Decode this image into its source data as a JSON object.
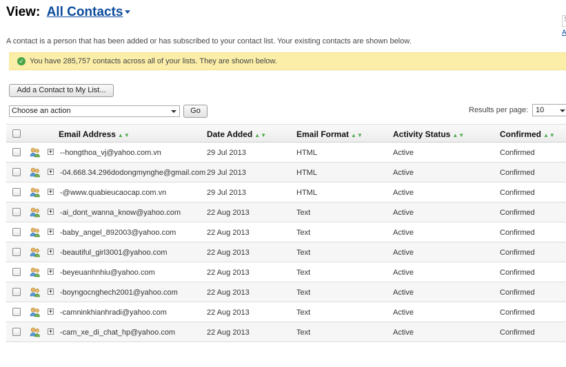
{
  "header": {
    "view_label": "View:",
    "view_value": "All Contacts",
    "edge_box_text": "S",
    "edge_link_text": "A"
  },
  "intro_text": "A contact is a person that has been added or has subscribed to your contact list. Your existing contacts are shown below.",
  "notice": {
    "text": "You have 285,757 contacts across all of your lists. They are shown below.",
    "icon": "check-circle-icon",
    "bg_color": "#fbeea9"
  },
  "toolbar": {
    "add_label": "Add a Contact to My List...",
    "action_value": "Choose an action",
    "go_label": "Go",
    "rpp_label": "Results per page:",
    "rpp_value": "10"
  },
  "columns": {
    "email": "Email Address",
    "date": "Date Added",
    "format": "Email Format",
    "status": "Activity Status",
    "confirmed": "Confirmed",
    "sort_icon": "sort-up-down-icon"
  },
  "rows": [
    {
      "email": "--hongthoa_vj@yahoo.com.vn",
      "date": "29 Jul 2013",
      "format": "HTML",
      "status": "Active",
      "confirmed": "Confirmed"
    },
    {
      "email": "-04.668.34.296dodongmynghe@gmail.com",
      "date": "29 Jul 2013",
      "format": "HTML",
      "status": "Active",
      "confirmed": "Confirmed"
    },
    {
      "email": "-@www.quabieucaocap.com.vn",
      "date": "29 Jul 2013",
      "format": "HTML",
      "status": "Active",
      "confirmed": "Confirmed"
    },
    {
      "email": "-ai_dont_wanna_know@yahoo.com",
      "date": "22 Aug 2013",
      "format": "Text",
      "status": "Active",
      "confirmed": "Confirmed"
    },
    {
      "email": "-baby_angel_892003@yahoo.com",
      "date": "22 Aug 2013",
      "format": "Text",
      "status": "Active",
      "confirmed": "Confirmed"
    },
    {
      "email": "-beautiful_girl3001@yahoo.com",
      "date": "22 Aug 2013",
      "format": "Text",
      "status": "Active",
      "confirmed": "Confirmed"
    },
    {
      "email": "-beyeuanhnhiu@yahoo.com",
      "date": "22 Aug 2013",
      "format": "Text",
      "status": "Active",
      "confirmed": "Confirmed"
    },
    {
      "email": "-boyngocnghech2001@yahoo.com",
      "date": "22 Aug 2013",
      "format": "Text",
      "status": "Active",
      "confirmed": "Confirmed"
    },
    {
      "email": "-camninkhianhradi@yahoo.com",
      "date": "22 Aug 2013",
      "format": "Text",
      "status": "Active",
      "confirmed": "Confirmed"
    },
    {
      "email": "-cam_xe_di_chat_hp@yahoo.com",
      "date": "22 Aug 2013",
      "format": "Text",
      "status": "Active",
      "confirmed": "Confirmed"
    }
  ]
}
